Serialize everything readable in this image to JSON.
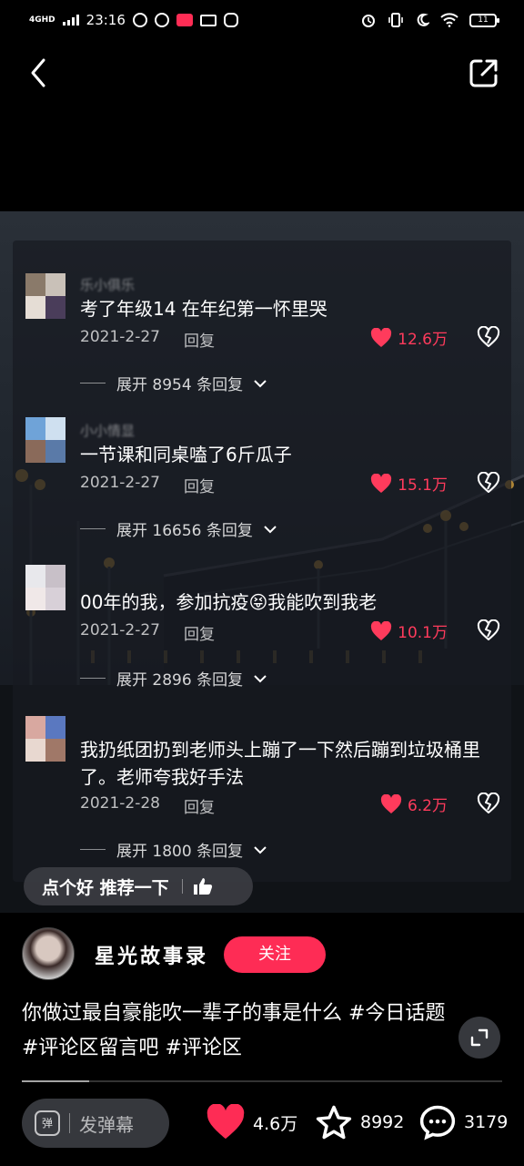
{
  "status_bar": {
    "network": "4GHD",
    "time": "23:16",
    "battery": "11"
  },
  "comments": [
    {
      "user": "乐小俱乐",
      "text": "考了年级14 在年纪第一怀里哭",
      "date": "2021-2-27",
      "reply_label": "回复",
      "likes": "12.6万",
      "expand": "展开 8954 条回复"
    },
    {
      "user": "小小情显",
      "text": "一节课和同桌嗑了6斤瓜子",
      "date": "2021-2-27",
      "reply_label": "回复",
      "likes": "15.1万",
      "expand": "展开 16656 条回复"
    },
    {
      "user": "",
      "text": "00年的我，参加抗疫😝我能吹到我老",
      "date": "2021-2-27",
      "reply_label": "回复",
      "likes": "10.1万",
      "expand": "展开 2896 条回复"
    },
    {
      "user": "",
      "text": "我扔纸团扔到老师头上蹦了一下然后蹦到垃圾桶里了。老师夸我好手法",
      "date": "2021-2-28",
      "reply_label": "回复",
      "likes": "6.2万",
      "expand": "展开 1800 条回复"
    }
  ],
  "recommend": {
    "label": "点个好 推荐一下"
  },
  "author": {
    "name": "星光故事录",
    "follow_label": "关注"
  },
  "description": {
    "text": "你做过最自豪能吹一辈子的事是什么 ",
    "tags": [
      "#今日话题",
      "#评论区留言吧",
      "#评论区"
    ]
  },
  "progress": {
    "fraction": 0.14
  },
  "bottom_bar": {
    "danmu_icon_label": "弹",
    "danmu_placeholder": "发弹幕",
    "likes": "4.6万",
    "favorites": "8992",
    "comments": "3179"
  },
  "colors": {
    "accent": "#fe2c55",
    "like_red": "#ff3b5c"
  }
}
